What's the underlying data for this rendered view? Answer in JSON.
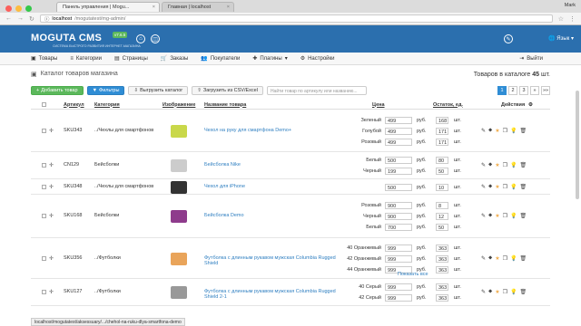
{
  "browser": {
    "tabs": [
      {
        "label": "Панель управления | Mogu..."
      },
      {
        "label": "Главная | localhost"
      }
    ],
    "profile": "Mark",
    "url_host": "localhost",
    "url_path": "/mogutatest/mg-admin/"
  },
  "topbar": {
    "logo": "MOGUTA CMS",
    "logo_sub": "СИСТЕМА БЫСТРОГО РАЗВИТИЯ ИНТЕРНЕТ-МАГАЗИНА",
    "version": "v7.6.5",
    "lang": "Язык"
  },
  "nav": {
    "items": [
      "Товары",
      "Категории",
      "Страницы",
      "Заказы",
      "Покупатели",
      "Плагины",
      "Настройки"
    ],
    "exit": "Выйти"
  },
  "page": {
    "title": "Каталог товаров магазина",
    "total_prefix": "Товаров в каталоге",
    "total_count": "45",
    "total_suffix": "шт."
  },
  "toolbar": {
    "add": "Добавить товар",
    "filters": "Фильтры",
    "export": "Выгрузить каталог",
    "import": "Загрузить из CSV/Excel",
    "search_placeholder": "Найти товар по артикулу или названию...",
    "pages": [
      "1",
      "2",
      "3",
      "»",
      "»»"
    ]
  },
  "headers": {
    "article": "Артикул",
    "category": "Категория",
    "image": "Изображение",
    "name": "Название товара",
    "price": "Цена",
    "stock": "Остаток, ед.",
    "actions": "Действия"
  },
  "rows": [
    {
      "sku": "SKU343",
      "cat": "../Чехлы для смартфонов",
      "name": "Чехол на руку для смартфона Demo+",
      "variants": [
        {
          "v": "Зеленый",
          "p": "499",
          "s": "168"
        },
        {
          "v": "Голубой",
          "p": "499",
          "s": "171"
        },
        {
          "v": "Розовый",
          "p": "499",
          "s": "171"
        }
      ]
    },
    {
      "sku": "CN129",
      "cat": "Бейсболки",
      "name": "Бейсболка Nike",
      "variants": [
        {
          "v": "Белый",
          "p": "500",
          "s": "80"
        },
        {
          "v": "Черный",
          "p": "199",
          "s": "50"
        }
      ]
    },
    {
      "sku": "SKU348",
      "cat": "../Чехлы для смартфонов",
      "name": "Чехол для iPhone",
      "variants": [
        {
          "v": "",
          "p": "500",
          "s": "10"
        }
      ]
    },
    {
      "sku": "SKU168",
      "cat": "Бейсболки",
      "name": "Бейсболка Demo",
      "variants": [
        {
          "v": "Розовый",
          "p": "900",
          "s": "8"
        },
        {
          "v": "Черный",
          "p": "900",
          "s": "12"
        },
        {
          "v": "Белый",
          "p": "700",
          "s": "50"
        }
      ]
    },
    {
      "sku": "SKU356",
      "cat": "../Футболки",
      "name": "Футболка с длинным рукавом мужская Columbia Rugged Shield",
      "variants": [
        {
          "v": "40 Оранжевый",
          "p": "999",
          "s": "363"
        },
        {
          "v": "42 Оранжевый",
          "p": "999",
          "s": "363"
        },
        {
          "v": "44 Оранжевый",
          "p": "999",
          "s": "363"
        }
      ],
      "show_all": "Показать все"
    },
    {
      "sku": "SKU127",
      "cat": "../Футболки",
      "name": "Футболка с длинным рукавом мужская Columbia Rugged Shield 2-1",
      "variants": [
        {
          "v": "40 Серый",
          "p": "999",
          "s": "363"
        },
        {
          "v": "42 Серый",
          "p": "999",
          "s": "363"
        }
      ]
    }
  ],
  "currency": "руб.",
  "unit": "шт.",
  "status_url": "localhost/mogutatest/aksessuary/.../chehol-na-ruku-dlya-smartfona-demo"
}
